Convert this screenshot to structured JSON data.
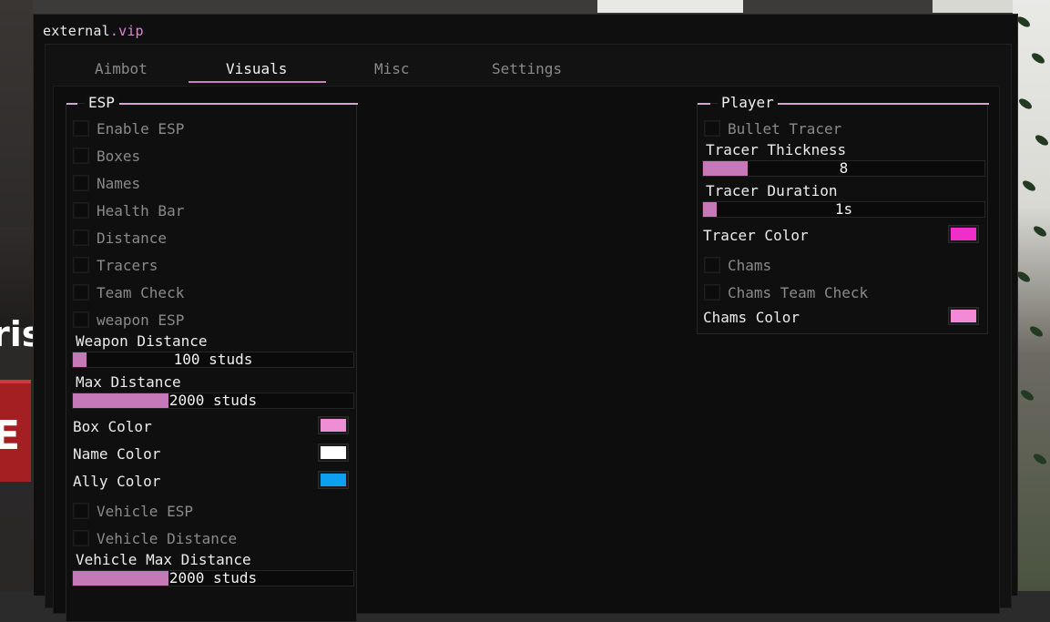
{
  "window": {
    "title_main": "external",
    "title_accent": ".vip"
  },
  "tabs": [
    {
      "label": "Aimbot"
    },
    {
      "label": "Visuals"
    },
    {
      "label": "Misc"
    },
    {
      "label": "Settings"
    }
  ],
  "active_tab": "Visuals",
  "esp": {
    "title": "ESP",
    "checkboxes": [
      {
        "label": "Enable ESP",
        "checked": false
      },
      {
        "label": "Boxes",
        "checked": false
      },
      {
        "label": "Names",
        "checked": false
      },
      {
        "label": "Health Bar",
        "checked": false
      },
      {
        "label": "Distance",
        "checked": false
      },
      {
        "label": "Tracers",
        "checked": false
      },
      {
        "label": "Team Check",
        "checked": false
      },
      {
        "label": "weapon ESP",
        "checked": false
      }
    ],
    "weapon_distance": {
      "label": "Weapon Distance",
      "value": "100 studs",
      "fill_fraction": 0.05
    },
    "max_distance": {
      "label": "Max Distance",
      "value": "2000 studs",
      "fill_fraction": 0.34
    },
    "colors": [
      {
        "label": "Box Color",
        "color": "#ee8fd6"
      },
      {
        "label": "Name Color",
        "color": "#ffffff"
      },
      {
        "label": "Ally Color",
        "color": "#0ea0f0"
      }
    ],
    "vehicle_checkboxes": [
      {
        "label": "Vehicle ESP",
        "checked": false
      },
      {
        "label": "Vehicle Distance",
        "checked": false
      }
    ],
    "vehicle_max_distance": {
      "label": "Vehicle Max Distance",
      "value": "2000 studs",
      "fill_fraction": 0.34
    }
  },
  "player": {
    "title": "Player",
    "bullet_tracer": {
      "label": "Bullet Tracer",
      "checked": false
    },
    "tracer_thickness": {
      "label": "Tracer Thickness",
      "value": "8",
      "fill_fraction": 0.16
    },
    "tracer_duration": {
      "label": "Tracer Duration",
      "value": "1s",
      "fill_fraction": 0.05
    },
    "tracer_color": {
      "label": "Tracer Color",
      "color": "#f22ec9"
    },
    "chams": {
      "label": "Chams",
      "checked": false
    },
    "chams_team_check": {
      "label": "Chams Team Check",
      "checked": false
    },
    "chams_color": {
      "label": "Chams Color",
      "color": "#f28ad8"
    }
  },
  "theme": {
    "accent": "#c678b8",
    "accent_line": "#d7a3d0",
    "background": "#0f0f0f"
  }
}
